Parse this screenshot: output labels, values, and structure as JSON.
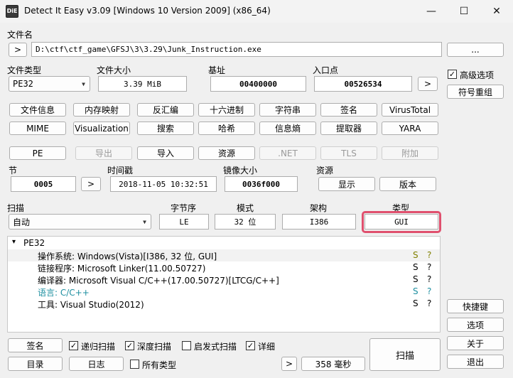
{
  "window": {
    "title": "Detect It Easy v3.09 [Windows 10 Version 2009] (x86_64)",
    "icon_text": "DiE",
    "minimize": "—",
    "maximize": "☐",
    "close": "✕"
  },
  "file": {
    "label": "文件名",
    "browse": ">",
    "path": "D:\\ctf\\ctf_game\\GFSJ\\3\\3.29\\Junk_Instruction.exe",
    "more": "..."
  },
  "info": {
    "type_label": "文件类型",
    "type_value": "PE32",
    "size_label": "文件大小",
    "size_value": "3.39 MiB",
    "base_label": "基址",
    "base_value": "00400000",
    "entry_label": "入口点",
    "entry_value": "00526534",
    "entry_btn": ">"
  },
  "side": {
    "advanced_label": "高级选项",
    "advanced_checked": "✓",
    "symbol_btn": "符号重组",
    "shortcut_btn": "快捷键",
    "options_btn": "选项",
    "about_btn": "关于",
    "exit_btn": "退出"
  },
  "tools_row1": [
    "文件信息",
    "内存映射",
    "反汇编",
    "十六进制",
    "字符串",
    "签名",
    "VirusTotal"
  ],
  "tools_row2": [
    "MIME",
    "Visualization",
    "搜索",
    "哈希",
    "信息熵",
    "提取器",
    "YARA"
  ],
  "pe_row": {
    "pe": "PE",
    "export": "导出",
    "import": "导入",
    "resource": "资源",
    "net": ".NET",
    "tls": "TLS",
    "overlay": "附加"
  },
  "pe_info": {
    "section_label": "节",
    "section_value": "0005",
    "section_btn": ">",
    "timestamp_label": "时间戳",
    "timestamp_value": "2018-11-05 10:32:51",
    "image_label": "镜像大小",
    "image_value": "0036f000",
    "resource_label": "资源",
    "show_btn": "显示",
    "version_btn": "版本"
  },
  "scan": {
    "label": "扫描",
    "mode_value": "自动",
    "endian_label": "字节序",
    "endian_value": "LE",
    "mode_label": "模式",
    "bits_value": "32 位",
    "arch_label": "架构",
    "arch_value": "I386",
    "type_label": "类型",
    "type_value": "GUI"
  },
  "tree": {
    "root_arrow": "▾",
    "root": "PE32",
    "rows": [
      {
        "text": "操作系统: Windows(Vista)[I386, 32 位, GUI]",
        "s": "S",
        "q": "?",
        "style": "hl"
      },
      {
        "text": "链接程序: Microsoft Linker(11.00.50727)",
        "s": "S",
        "q": "?",
        "style": ""
      },
      {
        "text": "编译器: Microsoft Visual C/C++(17.00.50727)[LTCG/C++]",
        "s": "S",
        "q": "?",
        "style": ""
      },
      {
        "text": "语言: C/C++",
        "s": "S",
        "q": "?",
        "style": "cyan"
      },
      {
        "text": "工具: Visual Studio(2012)",
        "s": "S",
        "q": "?",
        "style": ""
      }
    ]
  },
  "bottom": {
    "sign_btn": "签名",
    "recursive_label": "递归扫描",
    "recursive_checked": "✓",
    "deep_label": "深度扫描",
    "deep_checked": "✓",
    "heuristic_label": "启发式扫描",
    "verbose_label": "详细",
    "verbose_checked": "✓",
    "dir_btn": "目录",
    "log_btn": "日志",
    "alltypes_label": "所有类型",
    "nav_btn": ">",
    "time_value": "358 毫秒",
    "scan_btn": "扫描"
  }
}
